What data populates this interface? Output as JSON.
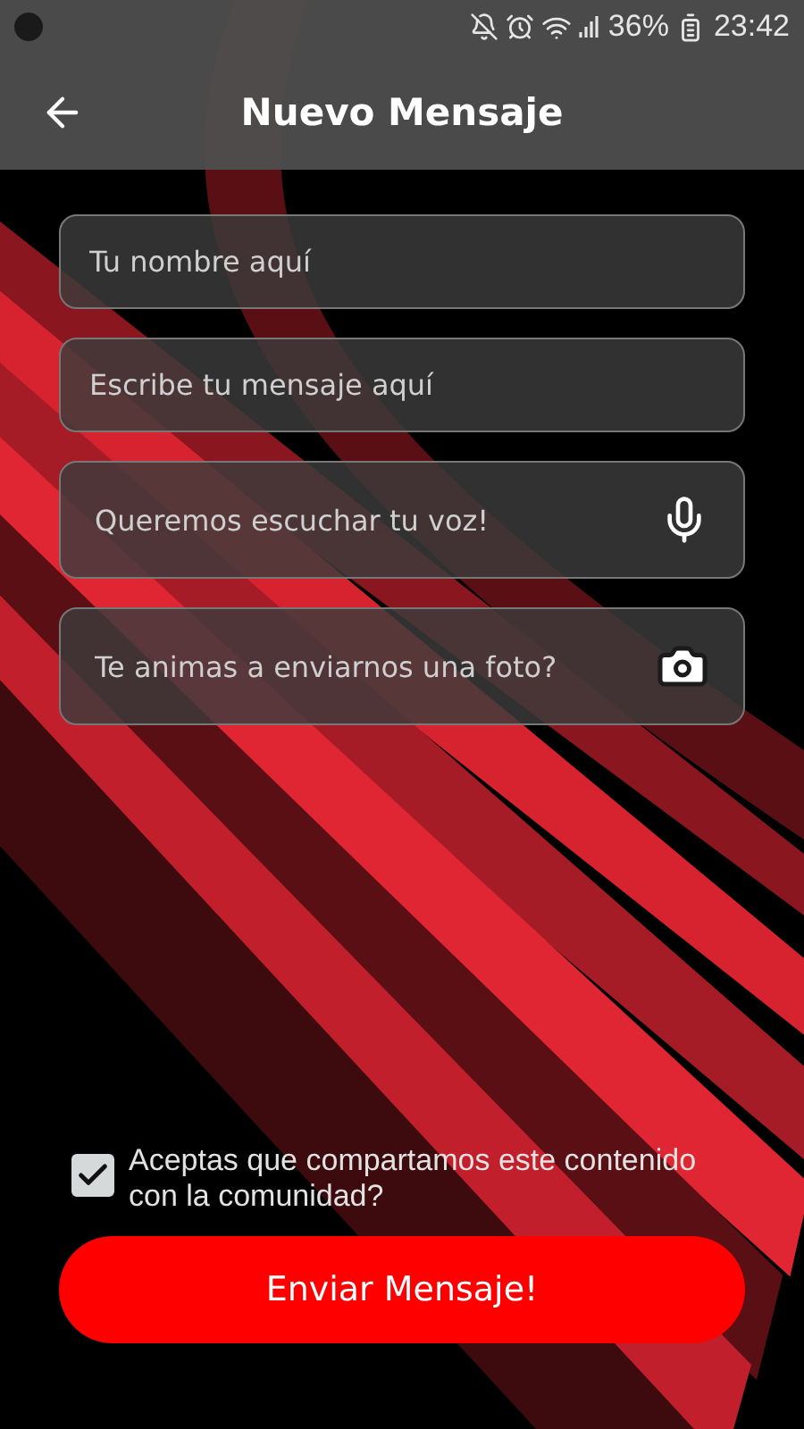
{
  "status_bar": {
    "battery": "36%",
    "time": "23:42"
  },
  "app_bar": {
    "title": "Nuevo Mensaje"
  },
  "fields": [
    {
      "kind": "text",
      "placeholder": "Tu nombre aquí"
    },
    {
      "kind": "text",
      "placeholder": "Escribe tu mensaje aquí"
    },
    {
      "kind": "voice",
      "placeholder": "Queremos escuchar tu voz!"
    },
    {
      "kind": "photo",
      "placeholder": "Te animas a enviarnos una foto?"
    }
  ],
  "consent": {
    "label": "Aceptas que compartamos este contenido con la comunidad?",
    "checked": true
  },
  "submit": {
    "label": "Enviar Mensaje!"
  }
}
